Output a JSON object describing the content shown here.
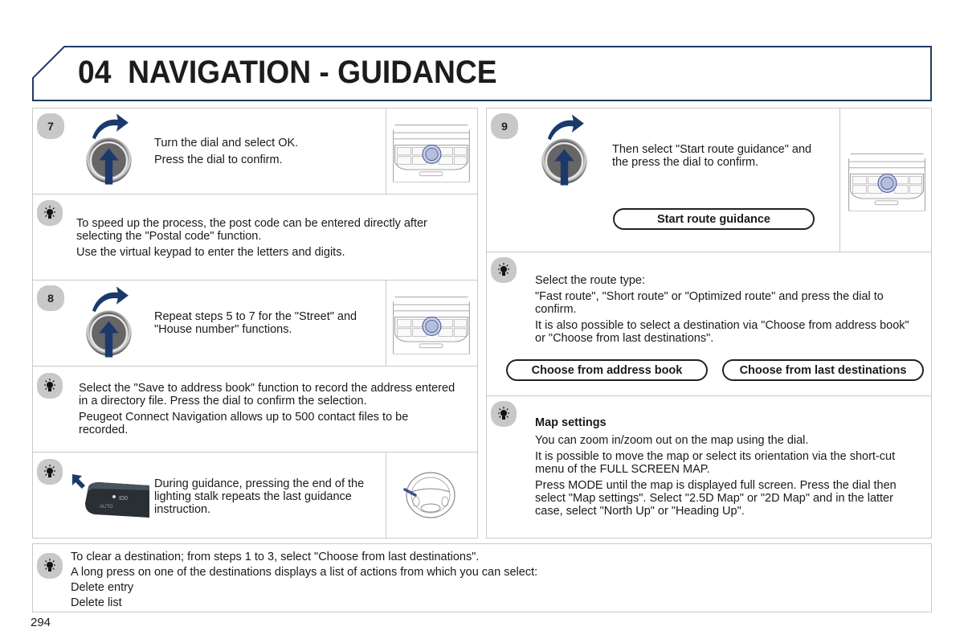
{
  "header": {
    "chapter_number": "04",
    "title": "NAVIGATION - GUIDANCE"
  },
  "left_column": {
    "step7": {
      "badge": "7",
      "lines": [
        "Turn the dial and select OK.",
        "Press the dial to confirm."
      ],
      "icon": "dial-turn-press-icon",
      "illustration": "radio-panel-icon"
    },
    "tip_postcode": {
      "icon": "lightbulb-tip-icon",
      "paragraphs": [
        "To speed up the process, the post code can be entered directly after selecting the \"Postal code\" function.",
        "Use the virtual keypad to enter the letters and digits."
      ]
    },
    "step8": {
      "badge": "8",
      "text": "Repeat steps 5 to 7 for the \"Street\" and \"House number\" functions.",
      "icon": "dial-turn-press-icon",
      "illustration": "radio-panel-icon"
    },
    "tip_address_book": {
      "icon": "lightbulb-tip-icon",
      "paragraphs": [
        "Select the \"Save to address book\" function to record the address entered in a directory file. Press the dial to confirm the selection.",
        "Peugeot Connect Navigation allows up to 500 contact files to be recorded."
      ]
    },
    "tip_lighting_stalk": {
      "icon": "lightbulb-tip-icon",
      "text": "During guidance, pressing the end of the lighting stalk repeats the last guidance instruction.",
      "illustration_left": "lighting-stalk-icon",
      "illustration_right": "steering-wheel-icon"
    }
  },
  "right_column": {
    "step9": {
      "badge": "9",
      "text": "Then select \"Start route guidance\" and the press the dial to confirm.",
      "button_label": "Start route guidance",
      "icon": "dial-turn-press-icon",
      "illustration": "radio-panel-icon"
    },
    "tip_route_type": {
      "icon": "lightbulb-tip-icon",
      "paragraphs": [
        "Select the route type:",
        "\"Fast route\", \"Short route\" or \"Optimized route\" and press the dial to confirm.",
        "It is also possible to select a destination via \"Choose from address book\" or \"Choose from last destinations\"."
      ],
      "buttons": [
        "Choose from address book",
        "Choose from last destinations"
      ]
    },
    "tip_map_settings": {
      "icon": "lightbulb-tip-icon",
      "heading": "Map settings",
      "paragraphs": [
        "You can zoom in/zoom out on the map using the dial.",
        "It is possible to move the map or select its orientation via the short-cut menu of the FULL SCREEN MAP.",
        "Press MODE until the map is displayed full screen. Press the dial then select \"Map settings\". Select \"2.5D Map\" or \"2D Map\" and in the latter case, select \"North Up\" or \"Heading Up\"."
      ]
    }
  },
  "bottom_tip": {
    "icon": "lightbulb-tip-icon",
    "lines": [
      "To clear a destination; from steps 1 to 3, select \"Choose from last destinations\".",
      "A long press on one of the destinations displays a list of actions from which you can select:",
      "Delete entry",
      "Delete list"
    ]
  },
  "page_number": "294",
  "colors": {
    "header_border": "#1f3b63",
    "panel_border": "#c9c9c9",
    "badge_gray": "#c8c8c8",
    "accent_navy": "#1b3a6b"
  }
}
